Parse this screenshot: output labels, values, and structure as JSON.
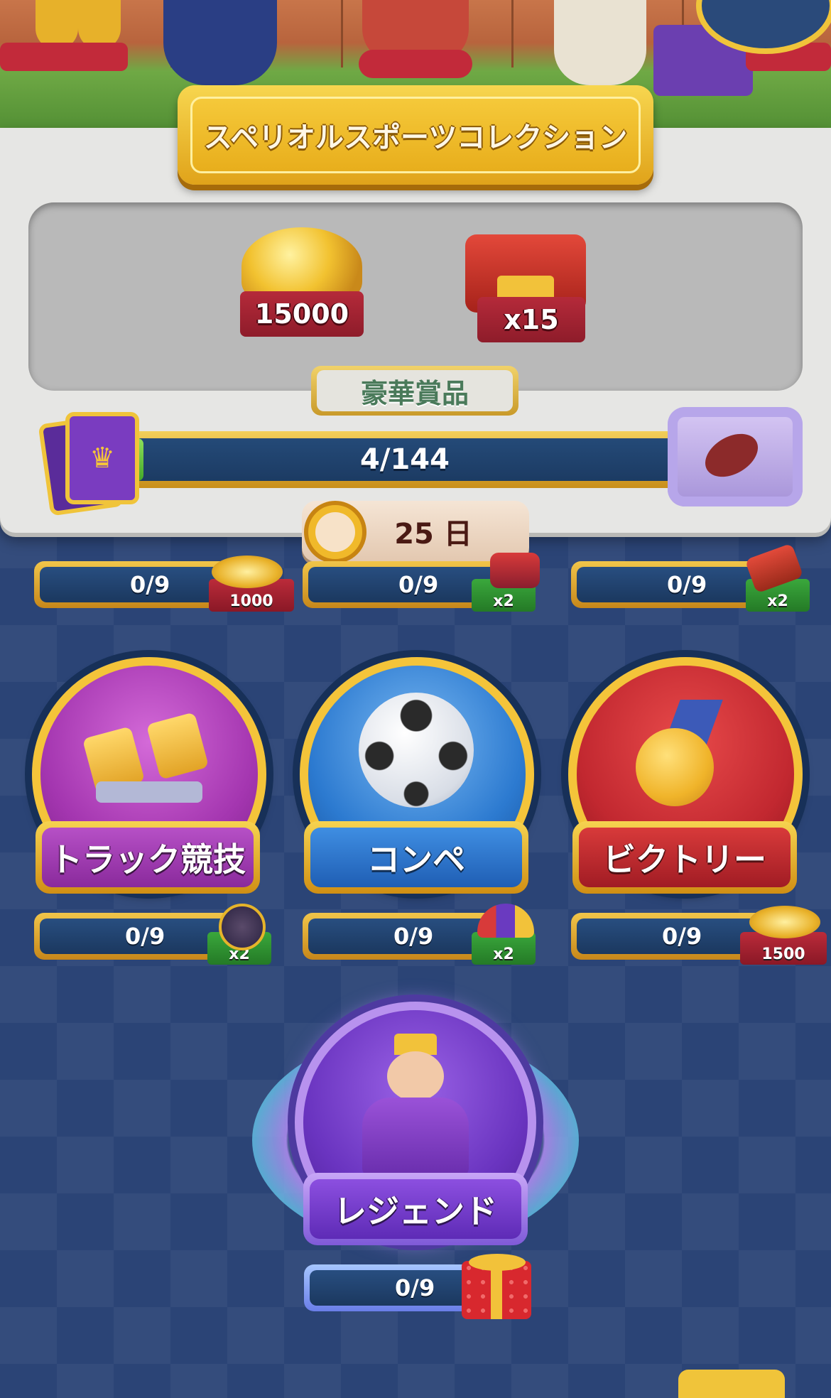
{
  "title": "スペリオルスポーツコレクション",
  "prizes": [
    {
      "icon": "gold-coins-icon",
      "value": "15000"
    },
    {
      "icon": "tnt-box-icon",
      "value": "x15"
    }
  ],
  "grand_prize_label": "豪華賞品",
  "progress": {
    "text": "4/144",
    "current": 4,
    "total": 144
  },
  "timer": "25 日",
  "top_row": [
    {
      "progress": "0/9",
      "reward": "1000",
      "reward_type": "coins"
    },
    {
      "progress": "0/9",
      "reward": "x2",
      "reward_type": "bag-booster"
    },
    {
      "progress": "0/9",
      "reward": "x2",
      "reward_type": "hammer-booster"
    }
  ],
  "sets": [
    {
      "label": "トラック競技",
      "progress": "0/9",
      "reward": "x2",
      "reward_type": "cannon-booster",
      "color": "#a93bb6"
    },
    {
      "label": "コンペ",
      "progress": "0/9",
      "reward": "x2",
      "reward_type": "jester-hat-booster",
      "color": "#2c7ad0"
    },
    {
      "label": "ビクトリー",
      "progress": "0/9",
      "reward": "1500",
      "reward_type": "coins",
      "color": "#c22830"
    }
  ],
  "legend": {
    "label": "レジェンド",
    "progress": "0/9",
    "reward_type": "gift-box"
  },
  "colors": {
    "gold": "#f4c43a",
    "navy": "#1b385f",
    "background": "#2b4476",
    "progress_green": "#43a829"
  }
}
